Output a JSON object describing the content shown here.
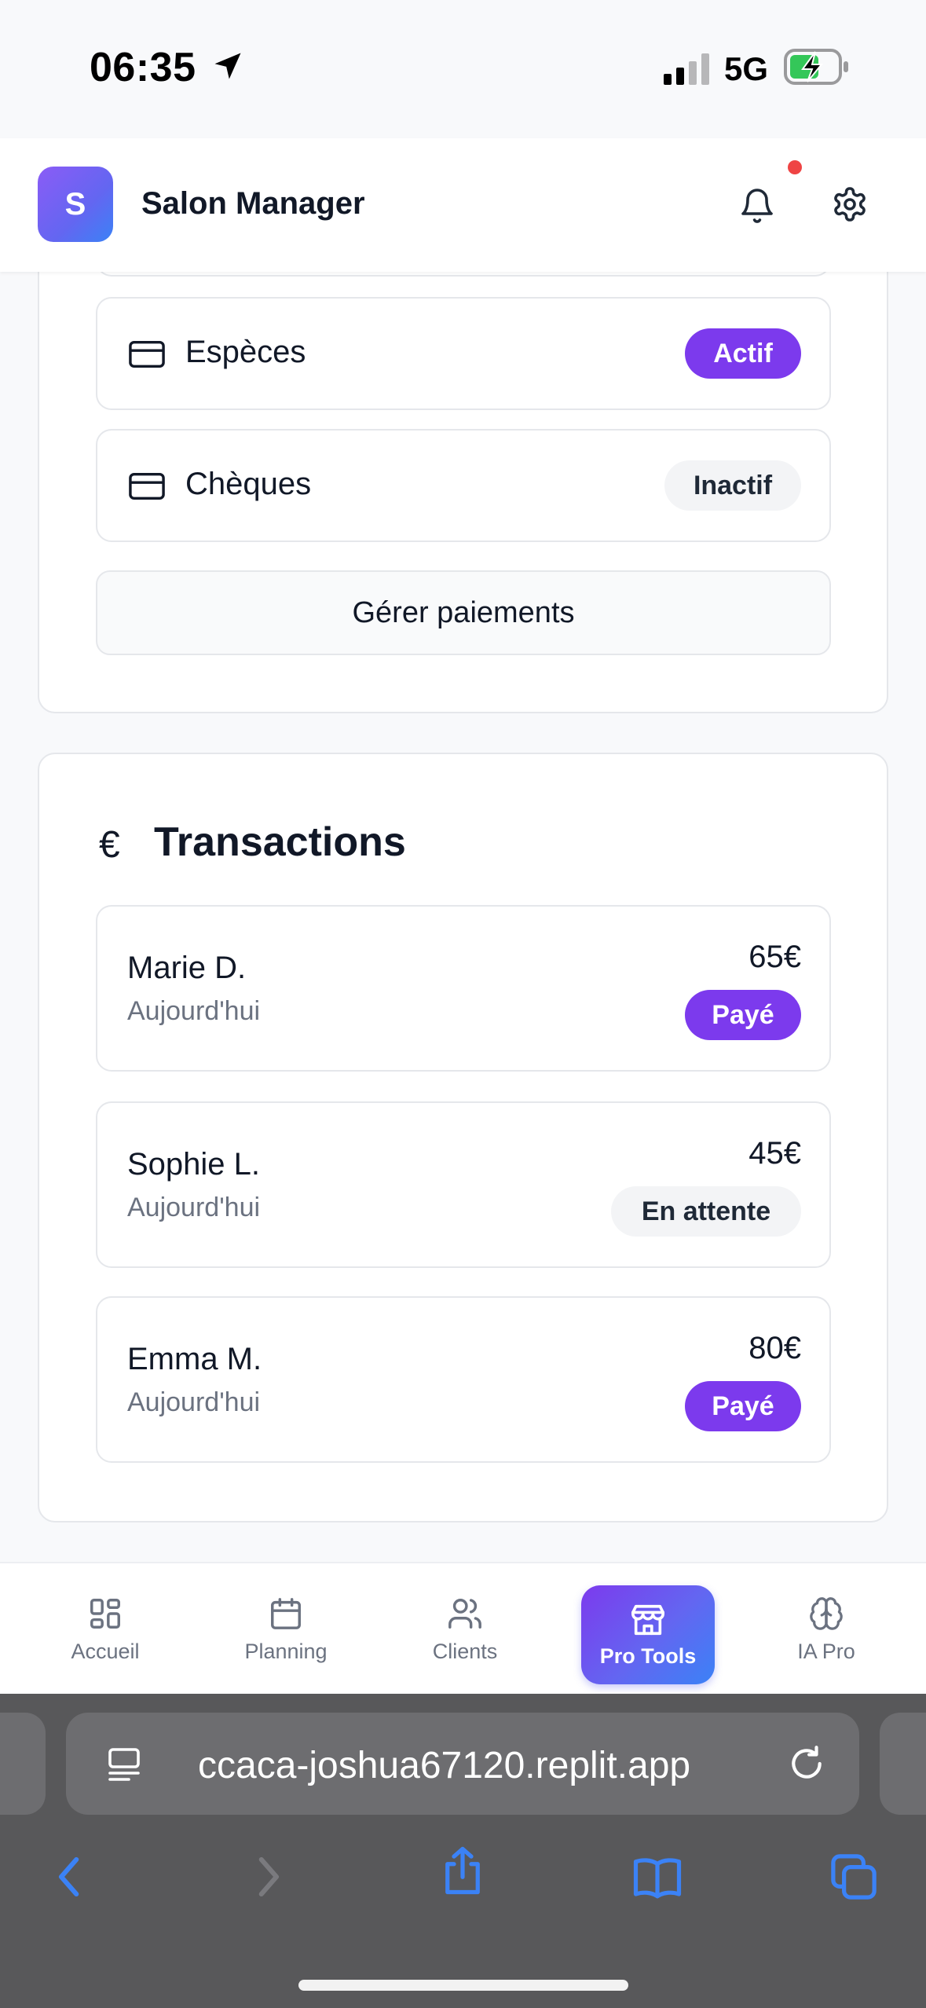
{
  "status_bar": {
    "time": "06:35",
    "network": "5G"
  },
  "header": {
    "logo_letter": "S",
    "title": "Salon Manager"
  },
  "payments": {
    "items": [
      {
        "label": "Espèces",
        "status": "Actif"
      },
      {
        "label": "Chèques",
        "status": "Inactif"
      }
    ],
    "manage_button": "Gérer paiements"
  },
  "transactions": {
    "title_icon": "€",
    "title": "Transactions",
    "items": [
      {
        "name": "Marie D.",
        "date": "Aujourd'hui",
        "amount": "65€",
        "status": "Payé"
      },
      {
        "name": "Sophie L.",
        "date": "Aujourd'hui",
        "amount": "45€",
        "status": "En attente"
      },
      {
        "name": "Emma M.",
        "date": "Aujourd'hui",
        "amount": "80€",
        "status": "Payé"
      }
    ]
  },
  "bottom_nav": {
    "items": [
      {
        "label": "Accueil",
        "icon": "grid-icon"
      },
      {
        "label": "Planning",
        "icon": "calendar-icon"
      },
      {
        "label": "Clients",
        "icon": "users-icon"
      },
      {
        "label": "Pro Tools",
        "icon": "store-icon",
        "active": true
      },
      {
        "label": "IA Pro",
        "icon": "brain-icon"
      }
    ]
  },
  "browser": {
    "url": "ccaca-joshua67120.replit.app"
  },
  "colors": {
    "accent": "#7c3aed",
    "gradient_end": "#3b82f6",
    "notification_dot": "#ef4444"
  }
}
